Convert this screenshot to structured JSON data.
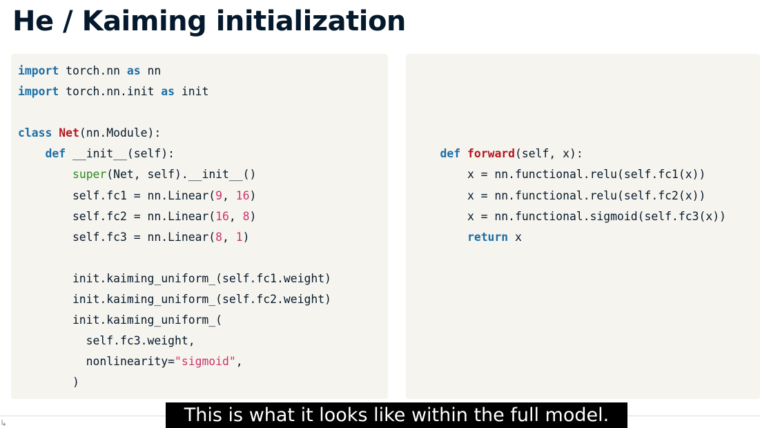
{
  "title": "He / Kaiming initialization",
  "caption": "This is what it looks like within the full model.",
  "left_code": [
    [
      {
        "t": "import",
        "c": "kw"
      },
      {
        "t": " torch.nn ",
        "c": "plain"
      },
      {
        "t": "as",
        "c": "kw"
      },
      {
        "t": " nn",
        "c": "plain"
      }
    ],
    [
      {
        "t": "import",
        "c": "kw"
      },
      {
        "t": " torch.nn.init ",
        "c": "plain"
      },
      {
        "t": "as",
        "c": "kw"
      },
      {
        "t": " init",
        "c": "plain"
      }
    ],
    [],
    [
      {
        "t": "class",
        "c": "kw"
      },
      {
        "t": " ",
        "c": "plain"
      },
      {
        "t": "Net",
        "c": "fn"
      },
      {
        "t": "(nn.Module):",
        "c": "plain"
      }
    ],
    [
      {
        "t": "    ",
        "c": "plain"
      },
      {
        "t": "def",
        "c": "kw"
      },
      {
        "t": " __init__(self):",
        "c": "plain"
      }
    ],
    [
      {
        "t": "        ",
        "c": "plain"
      },
      {
        "t": "super",
        "c": "bi"
      },
      {
        "t": "(Net, self).__init__()",
        "c": "plain"
      }
    ],
    [
      {
        "t": "        self.fc1 = nn.Linear(",
        "c": "plain"
      },
      {
        "t": "9",
        "c": "num"
      },
      {
        "t": ", ",
        "c": "plain"
      },
      {
        "t": "16",
        "c": "num"
      },
      {
        "t": ")",
        "c": "plain"
      }
    ],
    [
      {
        "t": "        self.fc2 = nn.Linear(",
        "c": "plain"
      },
      {
        "t": "16",
        "c": "num"
      },
      {
        "t": ", ",
        "c": "plain"
      },
      {
        "t": "8",
        "c": "num"
      },
      {
        "t": ")",
        "c": "plain"
      }
    ],
    [
      {
        "t": "        self.fc3 = nn.Linear(",
        "c": "plain"
      },
      {
        "t": "8",
        "c": "num"
      },
      {
        "t": ", ",
        "c": "plain"
      },
      {
        "t": "1",
        "c": "num"
      },
      {
        "t": ")",
        "c": "plain"
      }
    ],
    [],
    [
      {
        "t": "        init.kaiming_uniform_(self.fc1.weight)",
        "c": "plain"
      }
    ],
    [
      {
        "t": "        init.kaiming_uniform_(self.fc2.weight)",
        "c": "plain"
      }
    ],
    [
      {
        "t": "        init.kaiming_uniform_(",
        "c": "plain"
      }
    ],
    [
      {
        "t": "          self.fc3.weight,",
        "c": "plain"
      }
    ],
    [
      {
        "t": "          nonlinearity=",
        "c": "plain"
      },
      {
        "t": "\"sigmoid\"",
        "c": "str"
      },
      {
        "t": ",",
        "c": "plain"
      }
    ],
    [
      {
        "t": "        )",
        "c": "plain"
      }
    ]
  ],
  "right_code": [
    [],
    [],
    [],
    [],
    [
      {
        "t": "    ",
        "c": "plain"
      },
      {
        "t": "def",
        "c": "kw"
      },
      {
        "t": " ",
        "c": "plain"
      },
      {
        "t": "forward",
        "c": "fn"
      },
      {
        "t": "(self, x):",
        "c": "plain"
      }
    ],
    [
      {
        "t": "        x = nn.functional.relu(self.fc1(x))",
        "c": "plain"
      }
    ],
    [
      {
        "t": "        x = nn.functional.relu(self.fc2(x))",
        "c": "plain"
      }
    ],
    [
      {
        "t": "        x = nn.functional.sigmoid(self.fc3(x))",
        "c": "plain"
      }
    ],
    [
      {
        "t": "        ",
        "c": "plain"
      },
      {
        "t": "return",
        "c": "kw"
      },
      {
        "t": " x",
        "c": "plain"
      }
    ]
  ]
}
